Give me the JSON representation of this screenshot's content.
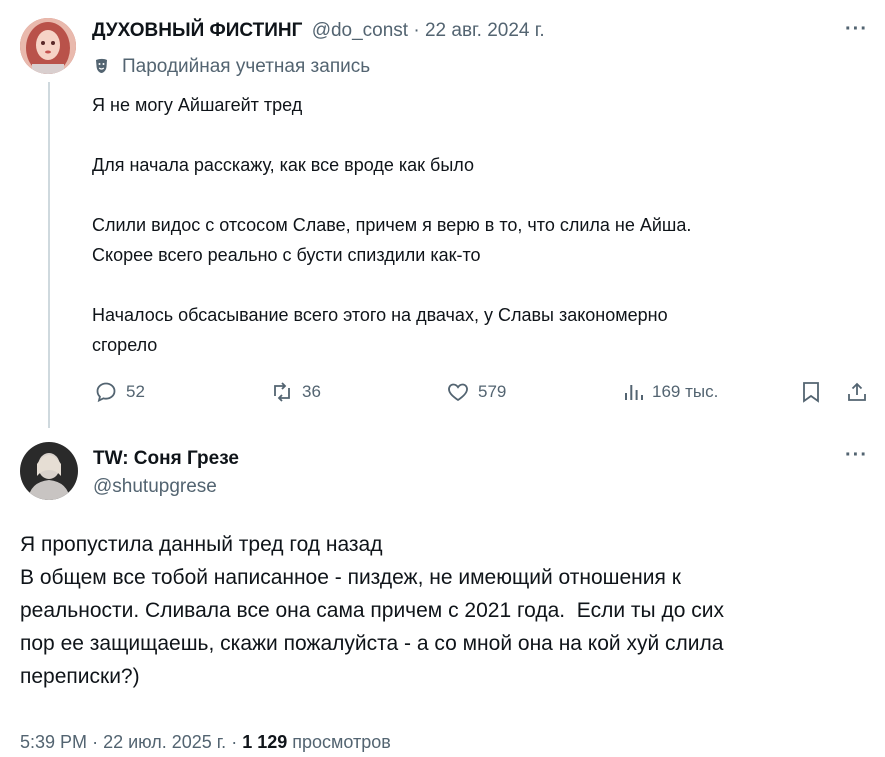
{
  "post1": {
    "display_name": "ДУХОВНЫЙ ФИСТИНГ",
    "handle": "@do_const",
    "separator": "·",
    "date": "22 авг. 2024 г.",
    "parody_label": "Пародийная учетная запись",
    "paragraphs": [
      [
        "Я не могу Айшагейт тред"
      ],
      [
        "Для начала расскажу, как все вроде как было"
      ],
      [
        "Слили видос с отсосом Славе, причем я верю в то, что слила не Айша.",
        "Скорее всего реально с бусти спиздили как-то"
      ],
      [
        "Началось обсасывание всего этого на двачах, у Славы закономерно",
        "сгорело"
      ]
    ],
    "actions": {
      "replies": "52",
      "reposts": "36",
      "likes": "579",
      "views": "169 тыс."
    },
    "more_label": "···"
  },
  "post2": {
    "display_name": "TW: Соня Грезе",
    "handle": "@shutupgrese",
    "more_label": "···",
    "lines": [
      "Я пропустила данный тред год назад",
      "В общем все тобой написанное - пиздеж, не имеющий отношения к",
      "реальности. Сливала все она сама причем с 2021 года.  Если ты до сих",
      "пор ее защищаешь, скажи пожалуйста - а со мной она на кой хуй слила",
      "переписки?)"
    ],
    "meta": {
      "time": "5:39 PM",
      "sep1": "·",
      "date": "22 июл. 2025 г.",
      "sep2": "·",
      "views_count": "1 129",
      "views_label": "просмотров"
    }
  },
  "colors": {
    "text": "#0f1419",
    "muted": "#536471",
    "thread_line": "#cfd9de"
  }
}
